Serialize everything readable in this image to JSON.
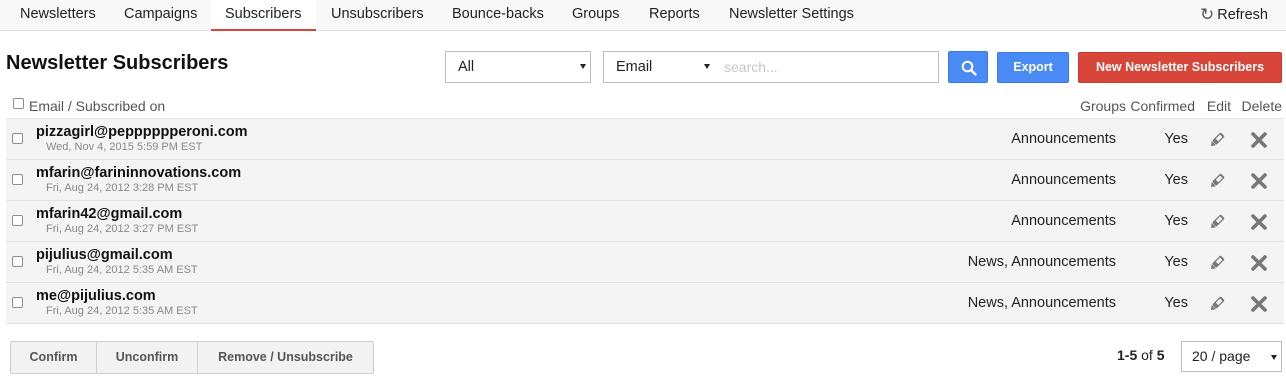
{
  "nav": {
    "tabs": [
      {
        "label": "Newsletters"
      },
      {
        "label": "Campaigns"
      },
      {
        "label": "Subscribers"
      },
      {
        "label": "Unsubscribers"
      },
      {
        "label": "Bounce-backs"
      },
      {
        "label": "Groups"
      },
      {
        "label": "Reports"
      },
      {
        "label": "Newsletter Settings"
      }
    ],
    "active_tab": "Subscribers",
    "refresh_label": "Refresh",
    "refresh_icon": "refresh-icon"
  },
  "page": {
    "title": "Newsletter Subscribers"
  },
  "toolbar": {
    "filter_value": "All",
    "field_value": "Email",
    "search_placeholder": "search...",
    "search_icon": "search-icon",
    "export_label": "Export",
    "new_label": "New Newsletter Subscribers"
  },
  "table": {
    "headers": {
      "email": "Email / Subscribed on",
      "groups": "Groups",
      "confirmed": "Confirmed",
      "edit": "Edit",
      "delete": "Delete"
    },
    "rows": [
      {
        "email": "pizzagirl@pepppppperoni.com",
        "date": "Wed, Nov 4, 2015 5:59 PM EST",
        "groups": "Announcements",
        "confirmed": "Yes"
      },
      {
        "email": "mfarin@farininnovations.com",
        "date": "Fri, Aug 24, 2012 3:28 PM EST",
        "groups": "Announcements",
        "confirmed": "Yes"
      },
      {
        "email": "mfarin42@gmail.com",
        "date": "Fri, Aug 24, 2012 3:27 PM EST",
        "groups": "Announcements",
        "confirmed": "Yes"
      },
      {
        "email": "pijulius@gmail.com",
        "date": "Fri, Aug 24, 2012 5:35 AM EST",
        "groups": "News, Announcements",
        "confirmed": "Yes"
      },
      {
        "email": "me@pijulius.com",
        "date": "Fri, Aug 24, 2012 5:35 AM EST",
        "groups": "News, Announcements",
        "confirmed": "Yes"
      }
    ],
    "edit_icon": "pencil-icon",
    "delete_icon": "close-icon"
  },
  "footer": {
    "confirm_label": "Confirm",
    "unconfirm_label": "Unconfirm",
    "remove_label": "Remove / Unsubscribe",
    "range": "1-5",
    "of_label": "of",
    "total": "5",
    "per_page": "20 / page"
  },
  "colors": {
    "accent_blue": "#4a8af4",
    "accent_red": "#d74638",
    "row_bg": "#f4f4f4"
  }
}
